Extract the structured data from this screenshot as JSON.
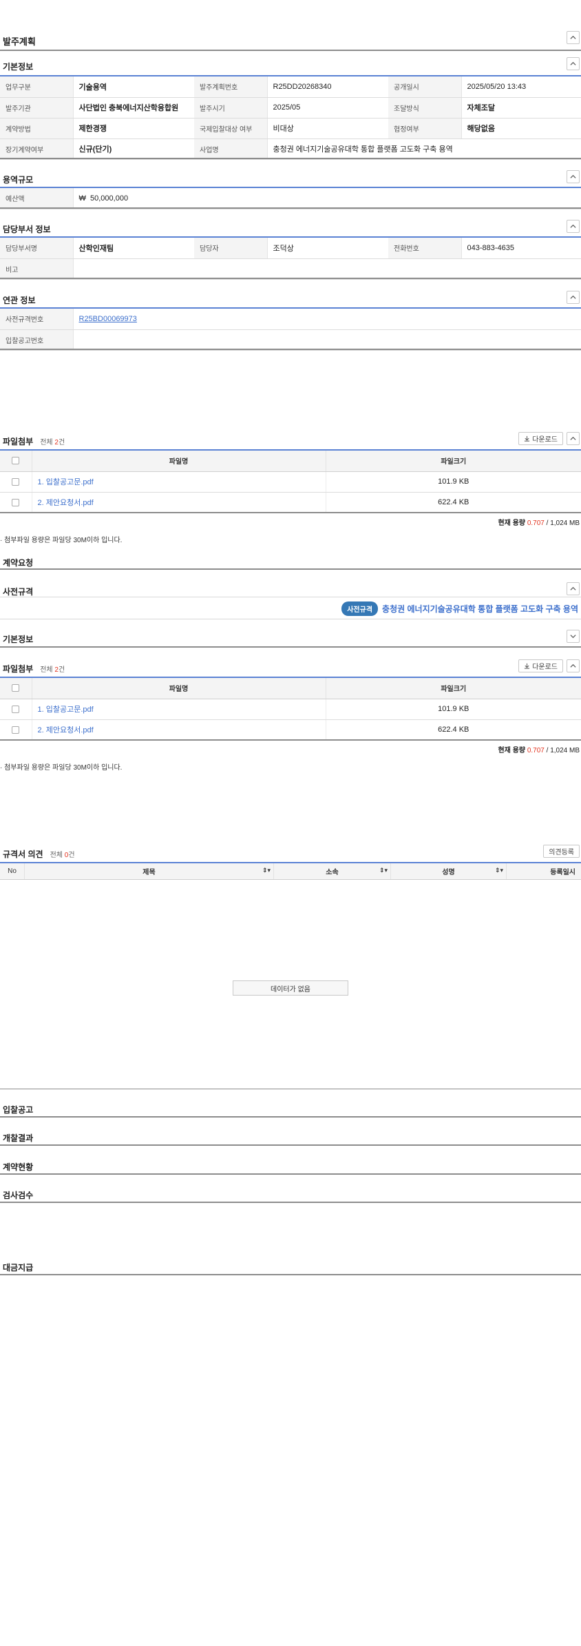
{
  "plan": {
    "title": "발주계획",
    "basic": {
      "title": "기본정보",
      "rows": [
        [
          {
            "label": "업무구분",
            "value": "기술용역",
            "bold": true
          },
          {
            "label": "발주계획번호",
            "value": "R25DD20268340",
            "bold": false
          },
          {
            "label": "공개일시",
            "value": "2025/05/20 13:43",
            "bold": false
          }
        ],
        [
          {
            "label": "발주기관",
            "value": "사단법인 충북에너지산학융합원",
            "bold": true
          },
          {
            "label": "발주시기",
            "value": "2025/05",
            "bold": false
          },
          {
            "label": "조달방식",
            "value": "자체조달",
            "bold": true
          }
        ],
        [
          {
            "label": "계약방법",
            "value": "제한경쟁",
            "bold": true
          },
          {
            "label": "국제입찰대상 여부",
            "value": "비대상",
            "bold": false
          },
          {
            "label": "협정여부",
            "value": "해당없음",
            "bold": true
          }
        ]
      ],
      "row4": {
        "label1": "장기계약여부",
        "value1": "신규(단기)",
        "label2": "사업명",
        "value2": "충청권 에너지기술공유대학 통합 플랫폼 고도화 구축 용역"
      }
    },
    "scale": {
      "title": "용역규모",
      "label": "예산액",
      "currency": "₩",
      "value": "50,000,000"
    },
    "dept": {
      "title": "담당부서 정보",
      "label1": "담당부서명",
      "value1": "산학인재팀",
      "label2": "담당자",
      "value2": "조덕상",
      "label3": "전화번호",
      "value3": "043-883-4635",
      "label4": "비고",
      "value4": ""
    },
    "related": {
      "title": "연관 정보",
      "label1": "사전규격번호",
      "value1": "R25BD00069973",
      "label2": "입찰공고번호",
      "value2": ""
    }
  },
  "attach1": {
    "title": "파일첨부",
    "total_prefix": "전체 ",
    "count": "2",
    "total_suffix": "건",
    "download": "다운로드",
    "col_name": "파일명",
    "col_size": "파일크기",
    "files": [
      {
        "name": "1. 입찰공고문.pdf",
        "size": "101.9 KB"
      },
      {
        "name": "2. 제안요청서.pdf",
        "size": "622.4 KB"
      }
    ],
    "usage_label": "현재 용량 ",
    "usage_value": "0.707",
    "usage_total": " / 1,024 MB",
    "note": "· 첨부파일 용량은 파일당 30M이하 입니다."
  },
  "contract_request": {
    "title": "계약요청"
  },
  "prespec": {
    "title": "사전규격",
    "badge": "사전규격",
    "project": "충청권 에너지기술공유대학 통합 플랫폼 고도화 구축 용역"
  },
  "basic2": {
    "title": "기본정보"
  },
  "attach2": {
    "title": "파일첨부",
    "total_prefix": "전체 ",
    "count": "2",
    "total_suffix": "건",
    "download": "다운로드",
    "col_name": "파일명",
    "col_size": "파일크기",
    "files": [
      {
        "name": "1. 입찰공고문.pdf",
        "size": "101.9 KB"
      },
      {
        "name": "2. 제안요청서.pdf",
        "size": "622.4 KB"
      }
    ],
    "usage_label": "현재 용량 ",
    "usage_value": "0.707",
    "usage_total": " / 1,024 MB",
    "note": "· 첨부파일 용량은 파일당 30M이하 입니다."
  },
  "opinions": {
    "title": "규격서 의견",
    "total_prefix": "전체 ",
    "count": "0",
    "total_suffix": "건",
    "register": "의견등록",
    "cols": {
      "no": "No",
      "subject": "제목",
      "org": "소속",
      "name": "성명",
      "date": "등록일시"
    },
    "empty": "데이터가 없음"
  },
  "sections": {
    "bid": "입찰공고",
    "result": "개찰결과",
    "contract_status": "계약현황",
    "inspect": "검사검수",
    "payment": "대금지급"
  },
  "colors": {
    "accent_blue": "#5a82d4",
    "badge": "#3578b5",
    "link": "#3c6fcc",
    "red": "#e2331f"
  }
}
